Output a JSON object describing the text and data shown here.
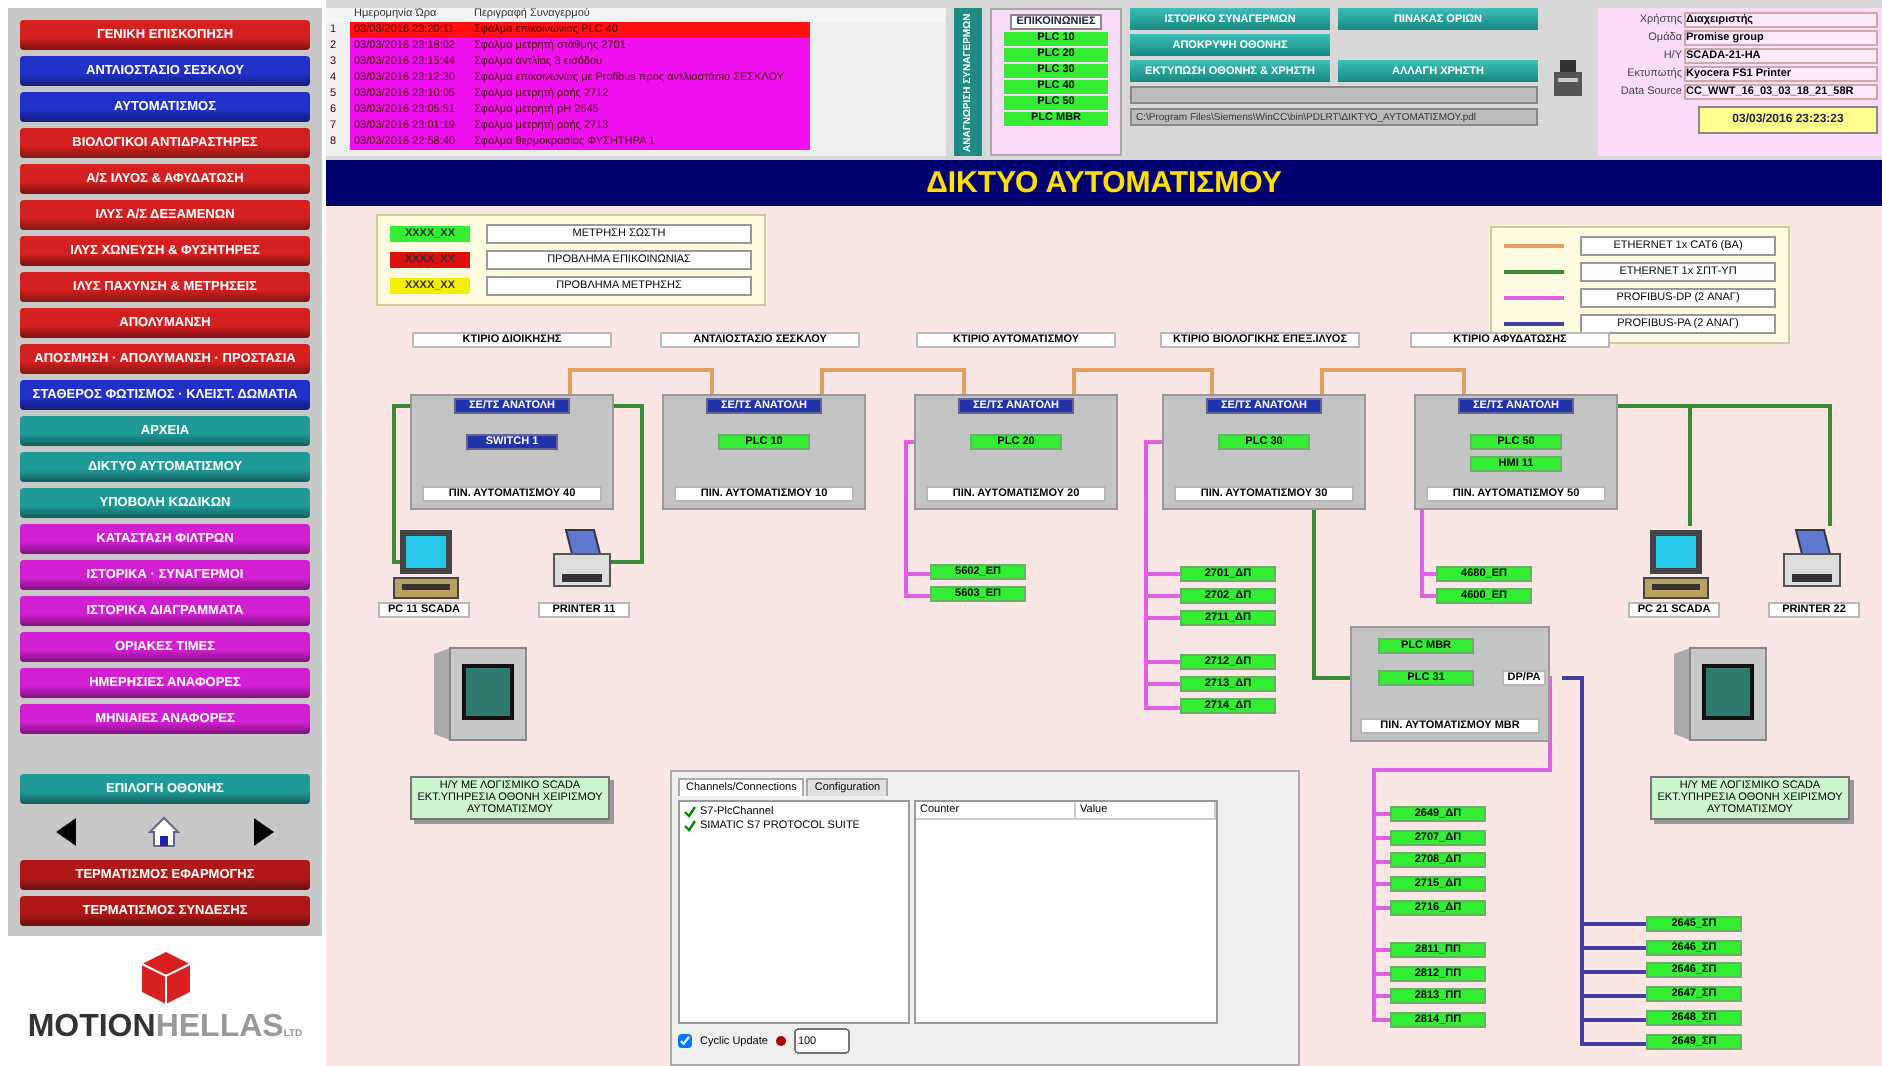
{
  "sidebar": {
    "items": [
      {
        "label": "ΓΕΝΙΚΗ ΕΠΙΣΚΟΠΗΣΗ",
        "color": "#d42020"
      },
      {
        "label": "ΑΝΤΛΙΟΣΤΑΣΙΟ ΣΕΣΚΛΟΥ",
        "color": "#2030c8"
      },
      {
        "label": "ΑΥΤΟΜΑΤΙΣΜΟΣ",
        "color": "#2030c8"
      },
      {
        "label": "ΒΙΟΛΟΓΙΚΟΙ ΑΝΤΙΔΡΑΣΤΗΡΕΣ",
        "color": "#d42020"
      },
      {
        "label": "Α/Σ ΙΛΥΟΣ & ΑΦΥΔΑΤΩΣΗ",
        "color": "#d42020"
      },
      {
        "label": "ΙΛΥΣ Α/Σ ΔΕΞΑΜΕΝΩΝ",
        "color": "#d42020"
      },
      {
        "label": "ΙΛΥΣ ΧΩΝΕΥΣΗ & ΦΥΣΗΤΗΡΕΣ",
        "color": "#d42020"
      },
      {
        "label": "ΙΛΥΣ ΠΑΧΥΝΣΗ & ΜΕΤΡΗΣΕΙΣ",
        "color": "#d42020"
      },
      {
        "label": "ΑΠΟΛΥΜΑΝΣΗ",
        "color": "#d42020"
      },
      {
        "label": "ΑΠΟΣΜΗΣΗ · ΑΠΟΛΥΜΑΝΣΗ · ΠΡΟΣΤΑΣΙΑ",
        "color": "#d42020"
      },
      {
        "label": "ΣΤΑΘΕΡΟΣ ΦΩΤΙΣΜΟΣ · ΚΛΕΙΣΤ. ΔΩΜΑΤΙΑ",
        "color": "#2030c8"
      },
      {
        "label": "ΑΡΧΕΙΑ",
        "color": "#1f9a96"
      },
      {
        "label": "ΔΙΚΤΥΟ ΑΥΤΟΜΑΤΙΣΜΟΥ",
        "color": "#1f9a96"
      },
      {
        "label": "ΥΠΟΒΟΛΗ ΚΩΔΙΚΩΝ",
        "color": "#1f9a96"
      },
      {
        "label": "ΚΑΤΑΣΤΑΣΗ ΦΙΛΤΡΩΝ",
        "color": "#d21fd2"
      },
      {
        "label": "ΙΣΤΟΡΙΚΑ · ΣΥΝΑΓΕΡΜΟΙ",
        "color": "#d21fd2"
      },
      {
        "label": "ΙΣΤΟΡΙΚΑ ΔΙΑΓΡΑΜΜΑΤΑ",
        "color": "#d21fd2"
      },
      {
        "label": "ΟΡΙΑΚΕΣ ΤΙΜΕΣ",
        "color": "#d21fd2"
      },
      {
        "label": "ΗΜΕΡΗΣΙΕΣ ΑΝΑΦΟΡΕΣ",
        "color": "#d21fd2"
      },
      {
        "label": "ΜΗΝΙΑΙΕΣ ΑΝΑΦΟΡΕΣ",
        "color": "#d21fd2"
      }
    ],
    "screen_select": "ΕΠΙΛΟΓΗ ΟΘΟΝΗΣ",
    "footer_buttons": [
      "ΤΕΡΜΑΤΙΣΜΟΣ ΕΦΑΡΜΟΓΗΣ",
      "ΤΕΡΜΑΤΙΣΜΟΣ ΣΥΝΔΕΣΗΣ"
    ],
    "logo": {
      "primary": "MOTION",
      "secondary": "HELLAS",
      "suffix": "LTD"
    }
  },
  "alarms": {
    "columns": [
      "Ημερομηνία Ώρα",
      "Περιγραφή Συναγερμού"
    ],
    "rows": [
      {
        "number": "1",
        "date": "03/03/2016 23:20:11",
        "description": "Σφάλμα επικοινωνίας PLC 40",
        "color": "#ff1010"
      },
      {
        "number": "2",
        "date": "03/03/2016 23:18:02",
        "description": "Σφάλμα μετρητή στάθμης 2701",
        "color": "#f010f0"
      },
      {
        "number": "3",
        "date": "03/03/2016 23:15:44",
        "description": "Σφάλμα αντλίας 3 εισόδου",
        "color": "#f010f0"
      },
      {
        "number": "4",
        "date": "03/03/2016 23:12:30",
        "description": "Σφάλμα επικοινωνίας με Profibus προς αντλιοστάσιο ΣΕΣΚΛΟΥ",
        "color": "#f010f0"
      },
      {
        "number": "5",
        "date": "03/03/2016 23:10:05",
        "description": "Σφάλμα μετρητή ροής 2712",
        "color": "#f010f0"
      },
      {
        "number": "6",
        "date": "03/03/2016 23:05:51",
        "description": "Σφάλμα μετρητή pH 2645",
        "color": "#f010f0"
      },
      {
        "number": "7",
        "date": "03/03/2016 23:01:19",
        "description": "Σφάλμα μετρητή ροής 2713",
        "color": "#f010f0"
      },
      {
        "number": "8",
        "date": "03/03/2016 22:58:40",
        "description": "Σφάλμα θερμοκρασίας ΦΥΣΗΤΗΡΑ 1",
        "color": "#f010f0"
      }
    ]
  },
  "ack_button": "ΑΝΑΓΝΩΡΙΣΗ ΣΥΝΑΓΕΡΜΩΝ",
  "communications": {
    "title": "ΕΠΙΚΟΙΝΩΝΙΕΣ",
    "items": [
      {
        "label": "PLC 10",
        "color": "#33ee33"
      },
      {
        "label": "PLC 20",
        "color": "#33ee33"
      },
      {
        "label": "PLC 30",
        "color": "#33ee33"
      },
      {
        "label": "PLC 40",
        "color": "#33ee33"
      },
      {
        "label": "PLC 50",
        "color": "#33ee33"
      },
      {
        "label": "PLC MBR",
        "color": "#33ee33"
      }
    ]
  },
  "actions": [
    "ΙΣΤΟΡΙΚΟ ΣΥΝΑΓΕΡΜΩΝ",
    "ΠΙΝΑΚΑΣ ΟΡΙΩΝ",
    "ΑΠΟΚΡΥΨΗ ΟΘΟΝΗΣ",
    "ΕΚΤΥΠΩΣΗ ΟΘΟΝΗΣ & ΧΡΗΣΤΗ",
    "ΑΛΛΑΓΗ ΧΡΗΣΤΗ"
  ],
  "path_field": "C:\\Program Files\\Siemens\\WinCC\\bin\\PDLRT\\ΔΙΚΤΥΟ_ΑΥΤΟΜΑΤΙΣΜΟΥ.pdl",
  "session": {
    "fields": [
      {
        "label": "Χρήστης",
        "value": "Διαχειριστής"
      },
      {
        "label": "Ομάδα",
        "value": "Promise group"
      },
      {
        "label": "Η/Υ",
        "value": "SCADA-21-HA"
      },
      {
        "label": "Εκτυπωτής",
        "value": "Kyocera FS1 Printer"
      },
      {
        "label": "Data Source",
        "value": "CC_WWT_16_03_03_18_21_58R"
      }
    ],
    "datetime": "03/03/2016 23:23:23"
  },
  "title": "ΔΙΚΤΥΟ ΑΥΤΟΜΑΤΙΣΜΟΥ",
  "status_legend": [
    {
      "sample": "XXXX_XX",
      "label": "ΜΕΤΡΗΣΗ ΣΩΣΤΗ",
      "color": "#33ee33"
    },
    {
      "sample": "XXXX_XX",
      "label": "ΠΡΟΒΛΗΜΑ ΕΠΙΚΟΙΝΩΝΙΑΣ",
      "color": "#dd1010"
    },
    {
      "sample": "XXXX_XX",
      "label": "ΠΡΟΒΛΗΜΑ ΜΕΤΡΗΣΗΣ",
      "color": "#f5f000"
    }
  ],
  "cable_legend": [
    {
      "label": "ETHERNET 1x CAT6 (ΒΑ)",
      "color": "#e0a060"
    },
    {
      "label": "ETHERNET 1x ΣΠΤ-ΥΠ",
      "color": "#3a8a3a"
    },
    {
      "label": "PROFIBUS-DP (2 ΑΝΑΓ)",
      "color": "#e060e0"
    },
    {
      "label": "PROFIBUS-PA (2 ΑΝΑΓ)",
      "color": "#4040a0"
    }
  ],
  "buildings": [
    "ΚΤΙΡΙΟ ΔΙΟΙΚΗΣΗΣ",
    "ΑΝΤΛΙΟΣΤΑΣΙΟ ΣΕΣΚΛΟΥ",
    "ΚΤΙΡΙΟ ΑΥΤΟΜΑΤΙΣΜΟΥ",
    "ΚΤΙΡΙΟ ΒΙΟΛΟΓΙΚΗΣ ΕΠΕΞ.ΙΛΥΟΣ",
    "ΚΤΙΡΙΟ ΑΦΥΔΑΤΩΣΗΣ"
  ],
  "cabinets": [
    {
      "switch": "ΣΕ/ΤΣ ΑΝΑΤΟΛΗ",
      "label": "ΠΙΝ. ΑΥΤΟΜΑΤΙΣΜΟΥ 40",
      "devices": [
        {
          "label": "SWITCH 1",
          "kind": "switch",
          "color": "#2233aa"
        }
      ]
    },
    {
      "switch": "ΣΕ/ΤΣ ΑΝΑΤΟΛΗ",
      "label": "ΠΙΝ. ΑΥΤΟΜΑΤΙΣΜΟΥ 10",
      "devices": [
        {
          "label": "PLC 10",
          "kind": "plc",
          "color": "#33ee33"
        }
      ]
    },
    {
      "switch": "ΣΕ/ΤΣ ΑΝΑΤΟΛΗ",
      "label": "ΠΙΝ. ΑΥΤΟΜΑΤΙΣΜΟΥ 20",
      "devices": [
        {
          "label": "PLC 20",
          "kind": "plc",
          "color": "#33ee33"
        }
      ]
    },
    {
      "switch": "ΣΕ/ΤΣ ΑΝΑΤΟΛΗ",
      "label": "ΠΙΝ. ΑΥΤΟΜΑΤΙΣΜΟΥ 30",
      "devices": [
        {
          "label": "PLC 30",
          "kind": "plc",
          "color": "#33ee33"
        }
      ]
    },
    {
      "switch": "ΣΕ/ΤΣ ΑΝΑΤΟΛΗ",
      "label": "ΠΙΝ. ΑΥΤΟΜΑΤΙΣΜΟΥ 50",
      "devices": [
        {
          "label": "PLC 50",
          "kind": "plc",
          "color": "#33ee33"
        },
        {
          "label": "HMI 11",
          "kind": "plc",
          "color": "#33ee33"
        }
      ]
    }
  ],
  "mbr_cabinet": {
    "label": "ΠΙΝ. ΑΥΤΟΜΑΤΙΣΜΟΥ MBR",
    "coupler": "DP/PA",
    "devices": [
      {
        "label": "PLC MBR",
        "color": "#33ee33"
      },
      {
        "label": "PLC 31",
        "color": "#33ee33"
      }
    ]
  },
  "io_groups": [
    {
      "items": [
        {
          "label": "5602_ΕΠ",
          "color": "#33ee33"
        },
        {
          "label": "5603_ΕΠ",
          "color": "#33ee33"
        }
      ]
    },
    {
      "items": [
        {
          "label": "2701_ΔΠ",
          "color": "#33ee33"
        },
        {
          "label": "2702_ΔΠ",
          "color": "#33ee33"
        },
        {
          "label": "2711_ΔΠ",
          "color": "#33ee33"
        }
      ]
    },
    {
      "items": [
        {
          "label": "2712_ΔΠ",
          "color": "#33ee33"
        },
        {
          "label": "2713_ΔΠ",
          "color": "#33ee33"
        },
        {
          "label": "2714_ΔΠ",
          "color": "#33ee33"
        }
      ]
    },
    {
      "items": [
        {
          "label": "4680_ΕΠ",
          "color": "#33ee33"
        },
        {
          "label": "4600_ΕΠ",
          "color": "#33ee33"
        }
      ]
    },
    {
      "items": [
        {
          "label": "2649_ΔΠ",
          "color": "#33ee33"
        },
        {
          "label": "2707_ΔΠ",
          "color": "#33ee33"
        },
        {
          "label": "2708_ΔΠ",
          "color": "#33ee33"
        },
        {
          "label": "2715_ΔΠ",
          "color": "#33ee33"
        },
        {
          "label": "2716_ΔΠ",
          "color": "#33ee33"
        }
      ]
    },
    {
      "items": [
        {
          "label": "2811_ΠΠ",
          "color": "#33ee33"
        },
        {
          "label": "2812_ΠΠ",
          "color": "#33ee33"
        },
        {
          "label": "2813_ΠΠ",
          "color": "#33ee33"
        },
        {
          "label": "2814_ΠΠ",
          "color": "#33ee33"
        }
      ]
    },
    {
      "items": [
        {
          "label": "2645_ΣΠ",
          "color": "#33ee33"
        },
        {
          "label": "2646_ΣΠ",
          "color": "#33ee33"
        },
        {
          "label": "2646_ΣΠ",
          "color": "#33ee33"
        },
        {
          "label": "2647_ΣΠ",
          "color": "#33ee33"
        },
        {
          "label": "2648_ΣΠ",
          "color": "#33ee33"
        },
        {
          "label": "2649_ΣΠ",
          "color": "#33ee33"
        }
      ]
    }
  ],
  "workstations": [
    {
      "label": "PC 11 SCADA",
      "kind": "pc"
    },
    {
      "label": "PRINTER 11",
      "kind": "printer"
    },
    {
      "label": "PC 21 SCADA",
      "kind": "pc"
    },
    {
      "label": "PRINTER 22",
      "kind": "printer"
    }
  ],
  "panel_notes": [
    "Η/Υ ΜΕ ΛΟΓΙΣΜΙΚΟ SCADA ΕΚΤ.ΥΠΗΡΕΣΙΑ ΟΘΟΝΗ ΧΕΙΡΙΣΜΟΥ ΑΥΤΟΜΑΤΙΣΜΟΥ",
    "Η/Υ ΜΕ ΛΟΓΙΣΜΙΚΟ SCADA ΕΚΤ.ΥΠΗΡΕΣΙΑ ΟΘΟΝΗ ΧΕΙΡΙΣΜΟΥ ΑΥΤΟΜΑΤΙΣΜΟΥ"
  ],
  "dialog": {
    "tabs": [
      {
        "label": "Channels/Connections",
        "selected": true
      },
      {
        "label": "Configuration",
        "selected": false
      }
    ],
    "tree": [
      {
        "label": "S7-PlcChannel",
        "checked": true
      },
      {
        "label": "SIMATIC S7 PROTOCOL SUITE",
        "checked": true
      }
    ],
    "columns": [
      "Counter",
      "Value"
    ],
    "cyclic": {
      "label": "Cyclic Update",
      "checked": true
    },
    "interval": "100"
  }
}
